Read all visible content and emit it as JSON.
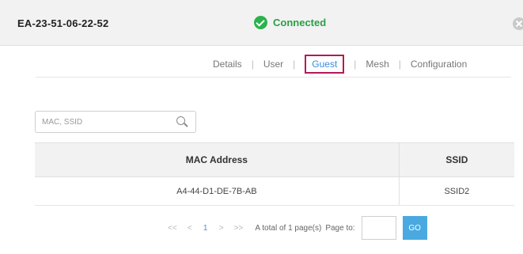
{
  "header": {
    "device_name": "EA-23-51-06-22-52",
    "status": "Connected"
  },
  "tabs": [
    "Details",
    "User",
    "Guest",
    "Mesh",
    "Configuration"
  ],
  "active_tab": "Guest",
  "search": {
    "placeholder": "MAC, SSID",
    "value": ""
  },
  "table": {
    "columns": [
      "MAC Address",
      "SSID"
    ],
    "rows": [
      [
        "A4-44-D1-DE-7B-AB",
        "SSID2"
      ]
    ]
  },
  "pagination": {
    "first": "<<",
    "prev": "<",
    "current_page": "1",
    "next": ">",
    "last": ">>",
    "total_text": "A total of 1 page(s)",
    "page_to_label": "Page to:",
    "go_label": "GO"
  },
  "colors": {
    "status_green": "#2bb24c",
    "accent_blue": "#49a9e0",
    "active_tab_border": "#b5195a"
  }
}
